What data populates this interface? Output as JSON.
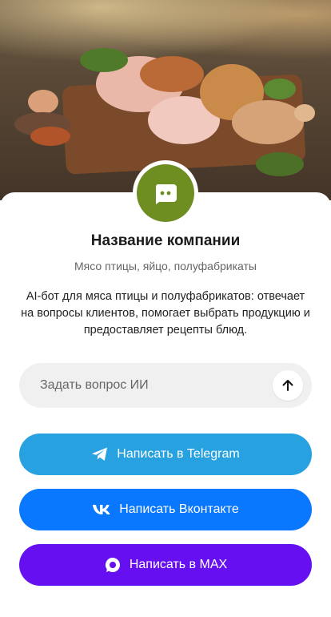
{
  "company": {
    "title": "Название компании",
    "subtitle": "Мясо птицы, яйцо, полуфабрикаты",
    "description": "AI-бот для мяса птицы и полуфабрикатов: отвечает на вопросы клиентов, помогает выбрать продукцию и предоставляет рецепты блюд."
  },
  "ask": {
    "placeholder": "Задать вопрос ИИ",
    "send_icon": "arrow-up-icon"
  },
  "buttons": {
    "telegram": "Написать в Telegram",
    "vk": "Написать Вконтакте",
    "max": "Написать в MAX"
  },
  "colors": {
    "avatar": "#6e8e22",
    "telegram": "#27a1e0",
    "vk": "#0a77ff",
    "max": "#6610f2"
  }
}
